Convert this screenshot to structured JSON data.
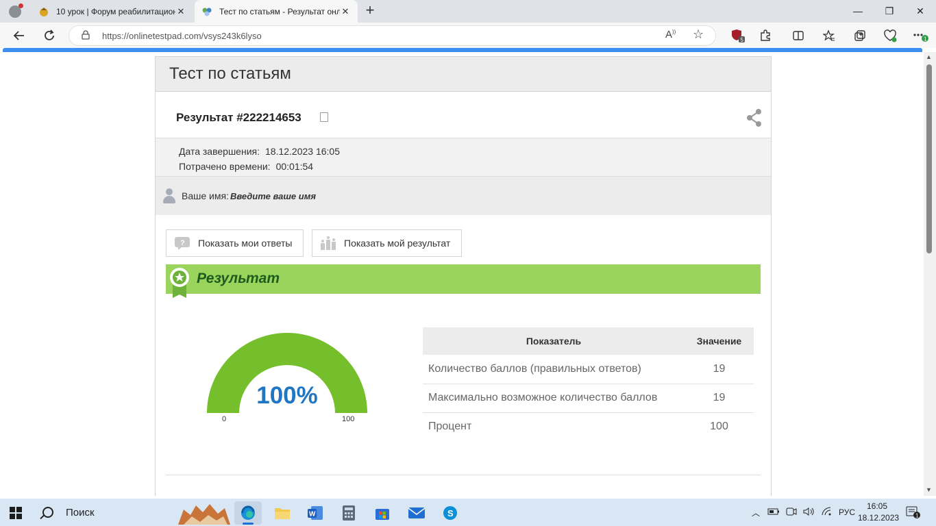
{
  "browser": {
    "tabs": [
      {
        "label": "10 урок | Форум реабилитацион",
        "icon": "forum-favicon-icon"
      },
      {
        "label": "Тест по статьям - Результат онл",
        "icon": "onlinetestpad-favicon-icon"
      }
    ],
    "url": "https://onlinetestpad.com/vsys243k6lyso",
    "extension_badge": "5",
    "update_badge": "1"
  },
  "page": {
    "header_title": "Тест по статьям",
    "result_title": "Результат #222214653",
    "completion_label": "Дата завершения:",
    "completion_value": "18.12.2023 16:05",
    "time_label": "Потрачено времени:",
    "time_value": "00:01:54",
    "name_label": "Ваше имя:",
    "name_placeholder": "Введите ваше имя",
    "show_answers_button": "Показать мои ответы",
    "show_result_button": "Показать мой результат",
    "result_banner": "Результат",
    "gauge": {
      "value_text": "100%",
      "value": 100,
      "min_label": "0",
      "max_label": "100",
      "color": "#75bf2c"
    },
    "table": {
      "headers": [
        "Показатель",
        "Значение"
      ],
      "rows": [
        {
          "indicator": "Количество баллов (правильных ответов)",
          "value": "19"
        },
        {
          "indicator": "Максимально возможное количество баллов",
          "value": "19"
        },
        {
          "indicator": "Процент",
          "value": "100"
        }
      ]
    }
  },
  "taskbar": {
    "search_label": "Поиск",
    "language": "РУС",
    "time": "16:05",
    "date": "18.12.2023",
    "notification_count": "1"
  },
  "colors": {
    "accent": "#3c8ef0",
    "banner": "#9bd45d",
    "gauge": "#75bf2c",
    "percent_text": "#1f76c2"
  }
}
